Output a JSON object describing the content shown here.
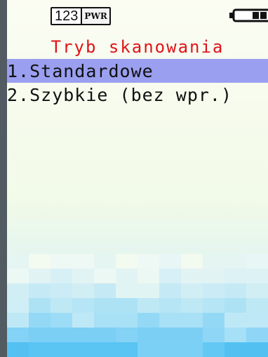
{
  "status_bar": {
    "input_mode": "123",
    "power_label": "PWR",
    "battery_icon": "battery-icon",
    "battery_level_fraction": 0.6
  },
  "screen": {
    "title": "Tryb skanowania",
    "menu_items": [
      {
        "label": "1.Standardowe",
        "selected": true
      },
      {
        "label": "2.Szybkie (bez wpr.)",
        "selected": false
      }
    ]
  },
  "colors": {
    "title_text": "#e0131a",
    "selection_highlight": "#9a9ff0",
    "background": "#fbfdf3",
    "device_frame": "#525a62"
  }
}
